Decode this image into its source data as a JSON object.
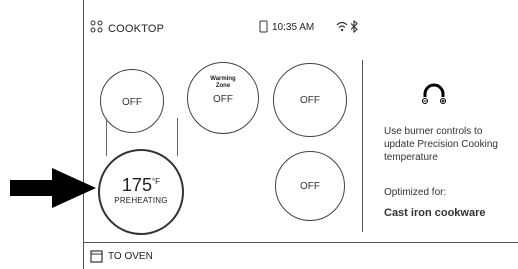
{
  "header": {
    "title": "COOKTOP",
    "time": "10:35 AM"
  },
  "burners": {
    "rear_left": {
      "label": "OFF"
    },
    "rear_center": {
      "zone_label_line1": "Warming",
      "zone_label_line2": "Zone",
      "label": "OFF"
    },
    "rear_right": {
      "label": "OFF"
    },
    "front_left": {
      "temperature": "175",
      "unit": "°F",
      "status": "PREHEATING"
    },
    "front_right": {
      "label": "OFF"
    }
  },
  "side_panel": {
    "instruction": "Use burner controls to update Precision Cooking temperature",
    "optimized_label": "Optimized for:",
    "cookware": "Cast iron cookware"
  },
  "footer": {
    "oven_label": "TO OVEN"
  },
  "icons": {
    "cooktop": "cooktop-grid-icon",
    "phone": "phone-icon",
    "wifi": "wifi-icon",
    "bluetooth": "bluetooth-icon",
    "probe": "probe-connector-icon",
    "oven": "oven-icon",
    "arrow": "pointer-arrow-icon"
  }
}
